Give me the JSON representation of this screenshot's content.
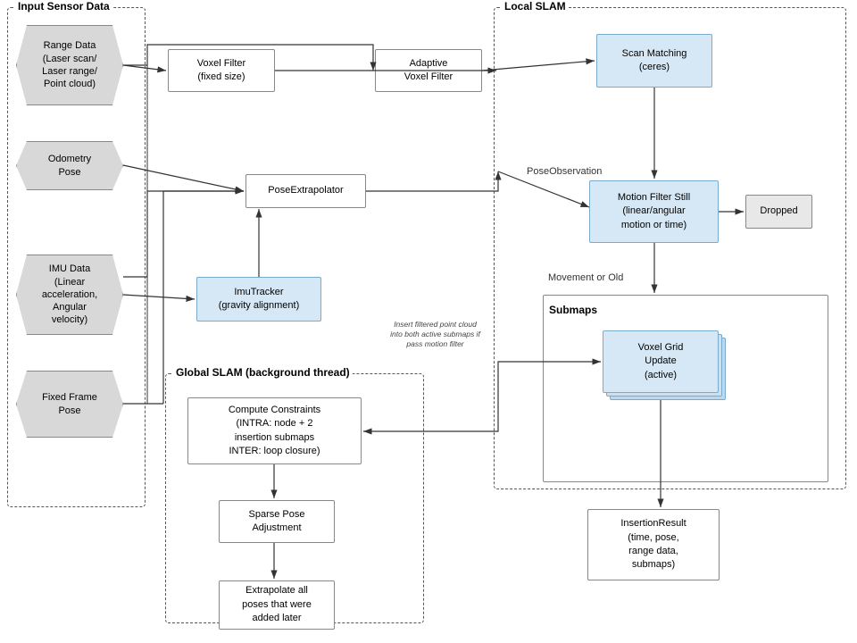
{
  "sections": {
    "input_sensor": {
      "label": "Input Sensor Data"
    },
    "local_slam": {
      "label": "Local SLAM"
    },
    "global_slam": {
      "label": "Global SLAM (background thread)"
    }
  },
  "nodes": {
    "range_data": "Range Data\n(Laser scan/\nLaser range/\nPoint cloud)",
    "odometry_pose": "Odometry\nPose",
    "imu_data": "IMU Data\n(Linear\nacceleration,\nAngular\nvelocity)",
    "fixed_frame_pose": "Fixed Frame\nPose",
    "voxel_filter": "Voxel Filter\n(fixed size)",
    "adaptive_voxel_filter": "Adaptive\nVoxel Filter",
    "pose_extrapolator": "PoseExtrapolator",
    "imu_tracker": "ImuTracker\n(gravity alignment)",
    "scan_matching": "Scan Matching\n(ceres)",
    "motion_filter": "Motion Filter Still\n(linear/angular\nmotion or time)",
    "dropped": "Dropped",
    "submaps_label": "Submaps",
    "voxel_grid": "Voxel Grid\nUpdate\n(active)",
    "compute_constraints": "Compute Constraints\n(INTRA: node + 2\ninsertion submaps\nINTER: loop closure)",
    "sparse_pose": "Sparse Pose\nAdjustment",
    "extrapolate_poses": "Extrapolate all\nposes that were\nadded later",
    "insertion_result": "InsertionResult\n(time, pose,\nrange data,\nsubmaps)",
    "pose_observation_label": "PoseObservation",
    "movement_or_old_label": "Movement or Old",
    "insert_filtered_label": "Insert filtered point cloud\ninto both active submaps if\npass motion filter"
  },
  "colors": {
    "hex_fill": "#d8d8d8",
    "hex_border": "#888888",
    "blue_fill": "#d6e8f5",
    "blue_border": "#7aabcc",
    "white_fill": "#ffffff",
    "gray_fill": "#e8e8e8",
    "dashed_border": "#555555",
    "arrow": "#333333"
  }
}
